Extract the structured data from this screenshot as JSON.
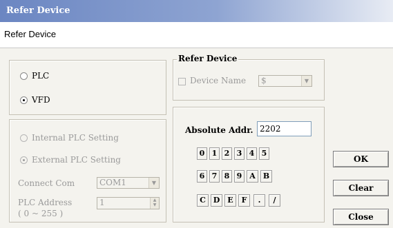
{
  "window": {
    "title": "Refer Device",
    "subtitle": "Refer Device"
  },
  "device_type": {
    "options": [
      {
        "label": "PLC",
        "checked": false
      },
      {
        "label": "VFD",
        "checked": true
      }
    ]
  },
  "plc_setting": {
    "internal_label": "Internal PLC Setting",
    "external_label": "External PLC Setting",
    "connect_com_label": "Connect Com",
    "connect_com_value": "COM1",
    "plc_address_label": "PLC Address",
    "plc_address_range": "( 0 ~ 255 )",
    "plc_address_value": "1"
  },
  "refer_device": {
    "legend": "Refer Device",
    "device_name_label": "Device Name",
    "device_value": "$"
  },
  "address": {
    "label": "Absolute Addr.",
    "value": "2202",
    "keys_row1": [
      "0",
      "1",
      "2",
      "3",
      "4",
      "5"
    ],
    "keys_row2": [
      "6",
      "7",
      "8",
      "9",
      "A",
      "B"
    ],
    "keys_row3": [
      "C",
      "D",
      "E",
      "F",
      ".",
      "/"
    ]
  },
  "buttons": {
    "ok": "OK",
    "clear": "Clear",
    "close": "Close"
  }
}
